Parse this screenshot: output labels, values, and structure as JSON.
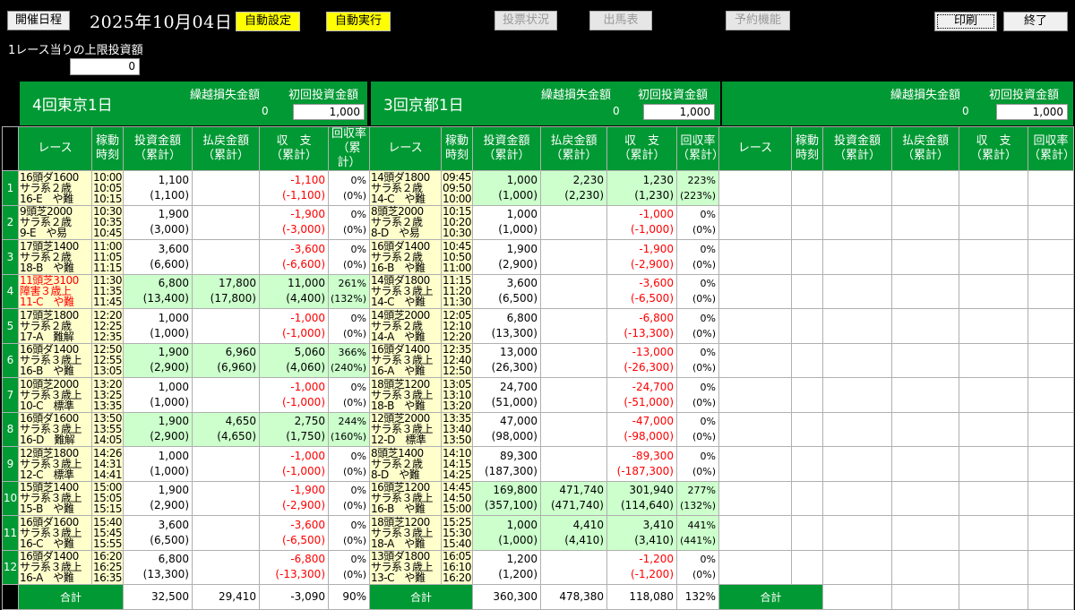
{
  "toolbar": {
    "schedule": "開催日程",
    "date": "2025年10月04日",
    "auto_setting": "自動設定",
    "auto_run": "自動実行",
    "vote_status": "投票状況",
    "entries": "出馬表",
    "reserve": "予約機能",
    "print": "印刷",
    "exit": "終了"
  },
  "limit": {
    "label": "1レース当りの上限投資額",
    "value": "0"
  },
  "venue_labels": {
    "carry": "繰越損失金額",
    "initial": "初回投資金額"
  },
  "venues": [
    {
      "name": "4回東京1日",
      "carry": "0",
      "initial": "1,000"
    },
    {
      "name": "3回京都1日",
      "carry": "0",
      "initial": "1,000"
    },
    {
      "name": "",
      "carry": "0",
      "initial": "1,000"
    }
  ],
  "headers": {
    "race": "レース",
    "time1": "稼動",
    "time2": "時刻",
    "inv1": "投資金額",
    "inv2": "（累計）",
    "pay1": "払戻金額",
    "pay2": "（累計）",
    "bal1": "収　支",
    "bal2": "（累計）",
    "rate1": "回収率",
    "rate2": "（累計）"
  },
  "totals": {
    "label": "合計"
  },
  "venue_totals": [
    {
      "inv": "32,500",
      "pay": "29,410",
      "bal": "-3,090",
      "rate": "90%"
    },
    {
      "inv": "360,300",
      "pay": "478,380",
      "bal": "118,080",
      "rate": "132%"
    }
  ],
  "rows": [
    {
      "n": "1",
      "v": [
        {
          "r1": "16頭ダ1600",
          "r2": "サラ系２歳",
          "r3": "16-E　や難",
          "t1": "10:00",
          "t2": "10:05",
          "t3": "10:15",
          "inv": "1,100",
          "invc": "(1,100)",
          "pay": "",
          "payc": "",
          "bal": "-1,100",
          "balc": "(-1,100)",
          "rate": "0%",
          "ratec": "(0%)"
        },
        {
          "r1": "14頭ダ1800",
          "r2": "サラ系２歳",
          "r3": "14-C　や難",
          "t1": "09:45",
          "t2": "09:50",
          "t3": "10:00",
          "inv": "1,000",
          "invc": "(1,000)",
          "pay": "2,230",
          "payc": "(2,230)",
          "bal": "1,230",
          "balc": "(1,230)",
          "rate": "223%",
          "ratec": "(223%)",
          "hl": true
        }
      ]
    },
    {
      "n": "2",
      "v": [
        {
          "r1": "9頭芝2000",
          "r2": "サラ系２歳",
          "r3": "9-E　や易",
          "t1": "10:30",
          "t2": "10:35",
          "t3": "10:45",
          "inv": "1,900",
          "invc": "(3,000)",
          "pay": "",
          "payc": "",
          "bal": "-1,900",
          "balc": "(-3,000)",
          "rate": "0%",
          "ratec": "(0%)"
        },
        {
          "r1": "8頭芝2000",
          "r2": "サラ系２歳",
          "r3": "8-D　や易",
          "t1": "10:15",
          "t2": "10:20",
          "t3": "10:30",
          "inv": "1,000",
          "invc": "(1,000)",
          "pay": "",
          "payc": "",
          "bal": "-1,000",
          "balc": "(-1,000)",
          "rate": "0%",
          "ratec": "(0%)"
        }
      ]
    },
    {
      "n": "3",
      "v": [
        {
          "r1": "17頭芝1400",
          "r2": "サラ系２歳",
          "r3": "18-B　や難",
          "t1": "11:00",
          "t2": "11:05",
          "t3": "11:15",
          "inv": "3,600",
          "invc": "(6,600)",
          "pay": "",
          "payc": "",
          "bal": "-3,600",
          "balc": "(-6,600)",
          "rate": "0%",
          "ratec": "(0%)"
        },
        {
          "r1": "16頭ダ1400",
          "r2": "サラ系２歳",
          "r3": "16-B　や難",
          "t1": "10:45",
          "t2": "10:50",
          "t3": "11:00",
          "inv": "1,900",
          "invc": "(2,900)",
          "pay": "",
          "payc": "",
          "bal": "-1,900",
          "balc": "(-2,900)",
          "rate": "0%",
          "ratec": "(0%)"
        }
      ]
    },
    {
      "n": "4",
      "v": [
        {
          "r1": "11頭芝3100",
          "r2": "障害３歳上",
          "r3": "11-C　や難",
          "t1": "11:30",
          "t2": "11:35",
          "t3": "11:45",
          "inv": "6,800",
          "invc": "(13,400)",
          "pay": "17,800",
          "payc": "(17,800)",
          "bal": "11,000",
          "balc": "(4,400)",
          "rate": "261%",
          "ratec": "(132%)",
          "hl": true,
          "red": true
        },
        {
          "r1": "14頭ダ1800",
          "r2": "サラ系３歳上",
          "r3": "14-C　や難",
          "t1": "11:15",
          "t2": "11:20",
          "t3": "11:30",
          "inv": "3,600",
          "invc": "(6,500)",
          "pay": "",
          "payc": "",
          "bal": "-3,600",
          "balc": "(-6,500)",
          "rate": "0%",
          "ratec": "(0%)"
        }
      ]
    },
    {
      "n": "5",
      "v": [
        {
          "r1": "17頭芝1800",
          "r2": "サラ系２歳",
          "r3": "17-A　難解",
          "t1": "12:20",
          "t2": "12:25",
          "t3": "12:35",
          "inv": "1,000",
          "invc": "(1,000)",
          "pay": "",
          "payc": "",
          "bal": "-1,000",
          "balc": "(-1,000)",
          "rate": "0%",
          "ratec": "(0%)"
        },
        {
          "r1": "14頭芝2000",
          "r2": "サラ系２歳",
          "r3": "14-A　や難",
          "t1": "12:05",
          "t2": "12:10",
          "t3": "12:20",
          "inv": "6,800",
          "invc": "(13,300)",
          "pay": "",
          "payc": "",
          "bal": "-6,800",
          "balc": "(-13,300)",
          "rate": "0%",
          "ratec": "(0%)"
        }
      ]
    },
    {
      "n": "6",
      "v": [
        {
          "r1": "16頭ダ1400",
          "r2": "サラ系３歳上",
          "r3": "16-B　や難",
          "t1": "12:50",
          "t2": "12:55",
          "t3": "13:05",
          "inv": "1,900",
          "invc": "(2,900)",
          "pay": "6,960",
          "payc": "(6,960)",
          "bal": "5,060",
          "balc": "(4,060)",
          "rate": "366%",
          "ratec": "(240%)",
          "hl": true
        },
        {
          "r1": "16頭ダ1400",
          "r2": "サラ系３歳上",
          "r3": "16-A　や難",
          "t1": "12:35",
          "t2": "12:40",
          "t3": "12:50",
          "inv": "13,000",
          "invc": "(26,300)",
          "pay": "",
          "payc": "",
          "bal": "-13,000",
          "balc": "(-26,300)",
          "rate": "0%",
          "ratec": "(0%)"
        }
      ]
    },
    {
      "n": "7",
      "v": [
        {
          "r1": "10頭芝2000",
          "r2": "サラ系３歳上",
          "r3": "10-C　標準",
          "t1": "13:20",
          "t2": "13:25",
          "t3": "13:35",
          "inv": "1,000",
          "invc": "(1,000)",
          "pay": "",
          "payc": "",
          "bal": "-1,000",
          "balc": "(-1,000)",
          "rate": "0%",
          "ratec": "(0%)"
        },
        {
          "r1": "18頭芝1200",
          "r2": "サラ系３歳上",
          "r3": "18-B　や難",
          "t1": "13:05",
          "t2": "13:10",
          "t3": "13:20",
          "inv": "24,700",
          "invc": "(51,000)",
          "pay": "",
          "payc": "",
          "bal": "-24,700",
          "balc": "(-51,000)",
          "rate": "0%",
          "ratec": "(0%)"
        }
      ]
    },
    {
      "n": "8",
      "v": [
        {
          "r1": "16頭ダ1600",
          "r2": "サラ系３歳上",
          "r3": "16-D　難解",
          "t1": "13:50",
          "t2": "13:55",
          "t3": "14:05",
          "inv": "1,900",
          "invc": "(2,900)",
          "pay": "4,650",
          "payc": "(4,650)",
          "bal": "2,750",
          "balc": "(1,750)",
          "rate": "244%",
          "ratec": "(160%)",
          "hl": true
        },
        {
          "r1": "12頭芝2000",
          "r2": "サラ系３歳上",
          "r3": "12-D　標準",
          "t1": "13:35",
          "t2": "13:40",
          "t3": "13:50",
          "inv": "47,000",
          "invc": "(98,000)",
          "pay": "",
          "payc": "",
          "bal": "-47,000",
          "balc": "(-98,000)",
          "rate": "0%",
          "ratec": "(0%)"
        }
      ]
    },
    {
      "n": "9",
      "v": [
        {
          "r1": "12頭芝1800",
          "r2": "サラ系３歳上",
          "r3": "12-C　標準",
          "t1": "14:26",
          "t2": "14:31",
          "t3": "14:41",
          "inv": "1,000",
          "invc": "(1,000)",
          "pay": "",
          "payc": "",
          "bal": "-1,000",
          "balc": "(-1,000)",
          "rate": "0%",
          "ratec": "(0%)"
        },
        {
          "r1": "8頭芝1400",
          "r2": "サラ系２歳",
          "r3": "8-D　や難",
          "t1": "14:10",
          "t2": "14:15",
          "t3": "14:25",
          "inv": "89,300",
          "invc": "(187,300)",
          "pay": "",
          "payc": "",
          "bal": "-89,300",
          "balc": "(-187,300)",
          "rate": "0%",
          "ratec": "(0%)"
        }
      ]
    },
    {
      "n": "10",
      "v": [
        {
          "r1": "15頭芝1400",
          "r2": "サラ系３歳上",
          "r3": "15-B　や難",
          "t1": "15:00",
          "t2": "15:05",
          "t3": "15:15",
          "inv": "1,900",
          "invc": "(2,900)",
          "pay": "",
          "payc": "",
          "bal": "-1,900",
          "balc": "(-2,900)",
          "rate": "0%",
          "ratec": "(0%)"
        },
        {
          "r1": "16頭芝1200",
          "r2": "サラ系３歳上",
          "r3": "16-B　や難",
          "t1": "14:45",
          "t2": "14:50",
          "t3": "15:00",
          "inv": "169,800",
          "invc": "(357,100)",
          "pay": "471,740",
          "payc": "(471,740)",
          "bal": "301,940",
          "balc": "(114,640)",
          "rate": "277%",
          "ratec": "(132%)",
          "hl": true
        }
      ]
    },
    {
      "n": "11",
      "v": [
        {
          "r1": "16頭ダ1600",
          "r2": "サラ系３歳上",
          "r3": "16-C　や難",
          "t1": "15:40",
          "t2": "15:45",
          "t3": "15:55",
          "inv": "3,600",
          "invc": "(6,500)",
          "pay": "",
          "payc": "",
          "bal": "-3,600",
          "balc": "(-6,500)",
          "rate": "0%",
          "ratec": "(0%)"
        },
        {
          "r1": "18頭芝1200",
          "r2": "サラ系３歳上",
          "r3": "18-A　や難",
          "t1": "15:25",
          "t2": "15:30",
          "t3": "15:40",
          "inv": "1,000",
          "invc": "(1,000)",
          "pay": "4,410",
          "payc": "(4,410)",
          "bal": "3,410",
          "balc": "(3,410)",
          "rate": "441%",
          "ratec": "(441%)",
          "hl": true
        }
      ]
    },
    {
      "n": "12",
      "v": [
        {
          "r1": "16頭ダ1400",
          "r2": "サラ系３歳上",
          "r3": "16-A　や難",
          "t1": "16:20",
          "t2": "16:25",
          "t3": "16:35",
          "inv": "6,800",
          "invc": "(13,300)",
          "pay": "",
          "payc": "",
          "bal": "-6,800",
          "balc": "(-13,300)",
          "rate": "0%",
          "ratec": "(0%)"
        },
        {
          "r1": "13頭ダ1800",
          "r2": "サラ系３歳上",
          "r3": "13-C　や難",
          "t1": "16:05",
          "t2": "16:10",
          "t3": "16:20",
          "inv": "1,200",
          "invc": "(1,200)",
          "pay": "",
          "payc": "",
          "bal": "-1,200",
          "balc": "(-1,200)",
          "rate": "0%",
          "ratec": "(0%)"
        }
      ]
    }
  ],
  "colors": {
    "green": "#009933",
    "highlight": "#ccffcc",
    "race_bg": "#ffffcc",
    "negative": "#ff0000",
    "button_yellow": "#ffff00"
  }
}
